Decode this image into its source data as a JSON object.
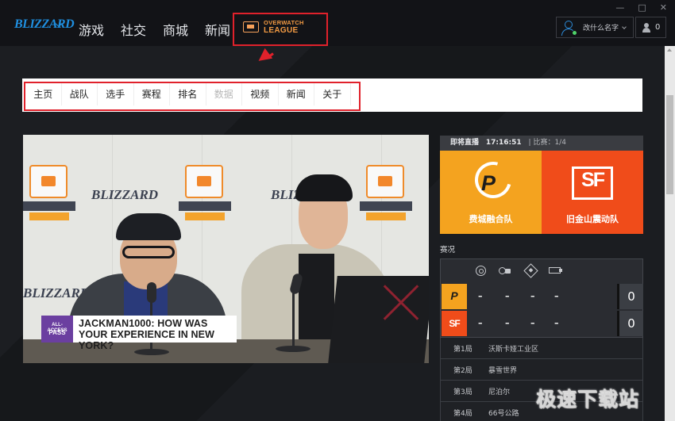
{
  "app": {
    "logo_text": "BLIZZARD",
    "nav": [
      "游戏",
      "社交",
      "商城",
      "新闻"
    ],
    "featured_tab": {
      "line1": "OVERWATCH",
      "line2": "LEAGUE"
    },
    "window_controls": [
      "—",
      "□",
      "✕"
    ],
    "username": "改什么名字",
    "friends_count": "0"
  },
  "subnav": {
    "items": [
      {
        "label": "主页"
      },
      {
        "label": "战队"
      },
      {
        "label": "选手"
      },
      {
        "label": "赛程"
      },
      {
        "label": "排名"
      },
      {
        "label": "数据"
      },
      {
        "label": "视频"
      },
      {
        "label": "新闻"
      },
      {
        "label": "关于"
      }
    ]
  },
  "video": {
    "lower_third_badge": [
      "ALL-ACCESS",
      "PASS"
    ],
    "lower_third_text": "JACKMAN1000: HOW WAS YOUR EXPERIENCE IN NEW YORK?",
    "backdrop_brand": "BLIZZARD"
  },
  "match": {
    "status_label": "即将直播",
    "time": "17:16:51",
    "score_label": "| 比赛：1/4",
    "team_a": {
      "name": "费城融合队",
      "short": "P",
      "color": "#f4a31f",
      "total": "0",
      "map_scores": [
        "–",
        "–",
        "–",
        "–"
      ]
    },
    "team_b": {
      "name": "旧金山震动队",
      "short": "SF",
      "color": "#f04c1a",
      "total": "0",
      "map_scores": [
        "–",
        "–",
        "–",
        "–"
      ]
    },
    "section_label": "赛况",
    "map_type_icons": [
      "control-map-icon",
      "hybrid-map-icon",
      "assault-map-icon",
      "escort-map-icon"
    ],
    "maps": [
      {
        "game": "第1局",
        "name": "沃斯卡娅工业区"
      },
      {
        "game": "第2局",
        "name": "暴雪世界"
      },
      {
        "game": "第3局",
        "name": "尼泊尔"
      },
      {
        "game": "第4局",
        "name": "66号公路"
      }
    ]
  },
  "watermark": "极速下载站",
  "colors": {
    "highlight_red": "#e0212b",
    "owl_orange": "#f29a43",
    "brand_blue": "#1f8fe0"
  }
}
